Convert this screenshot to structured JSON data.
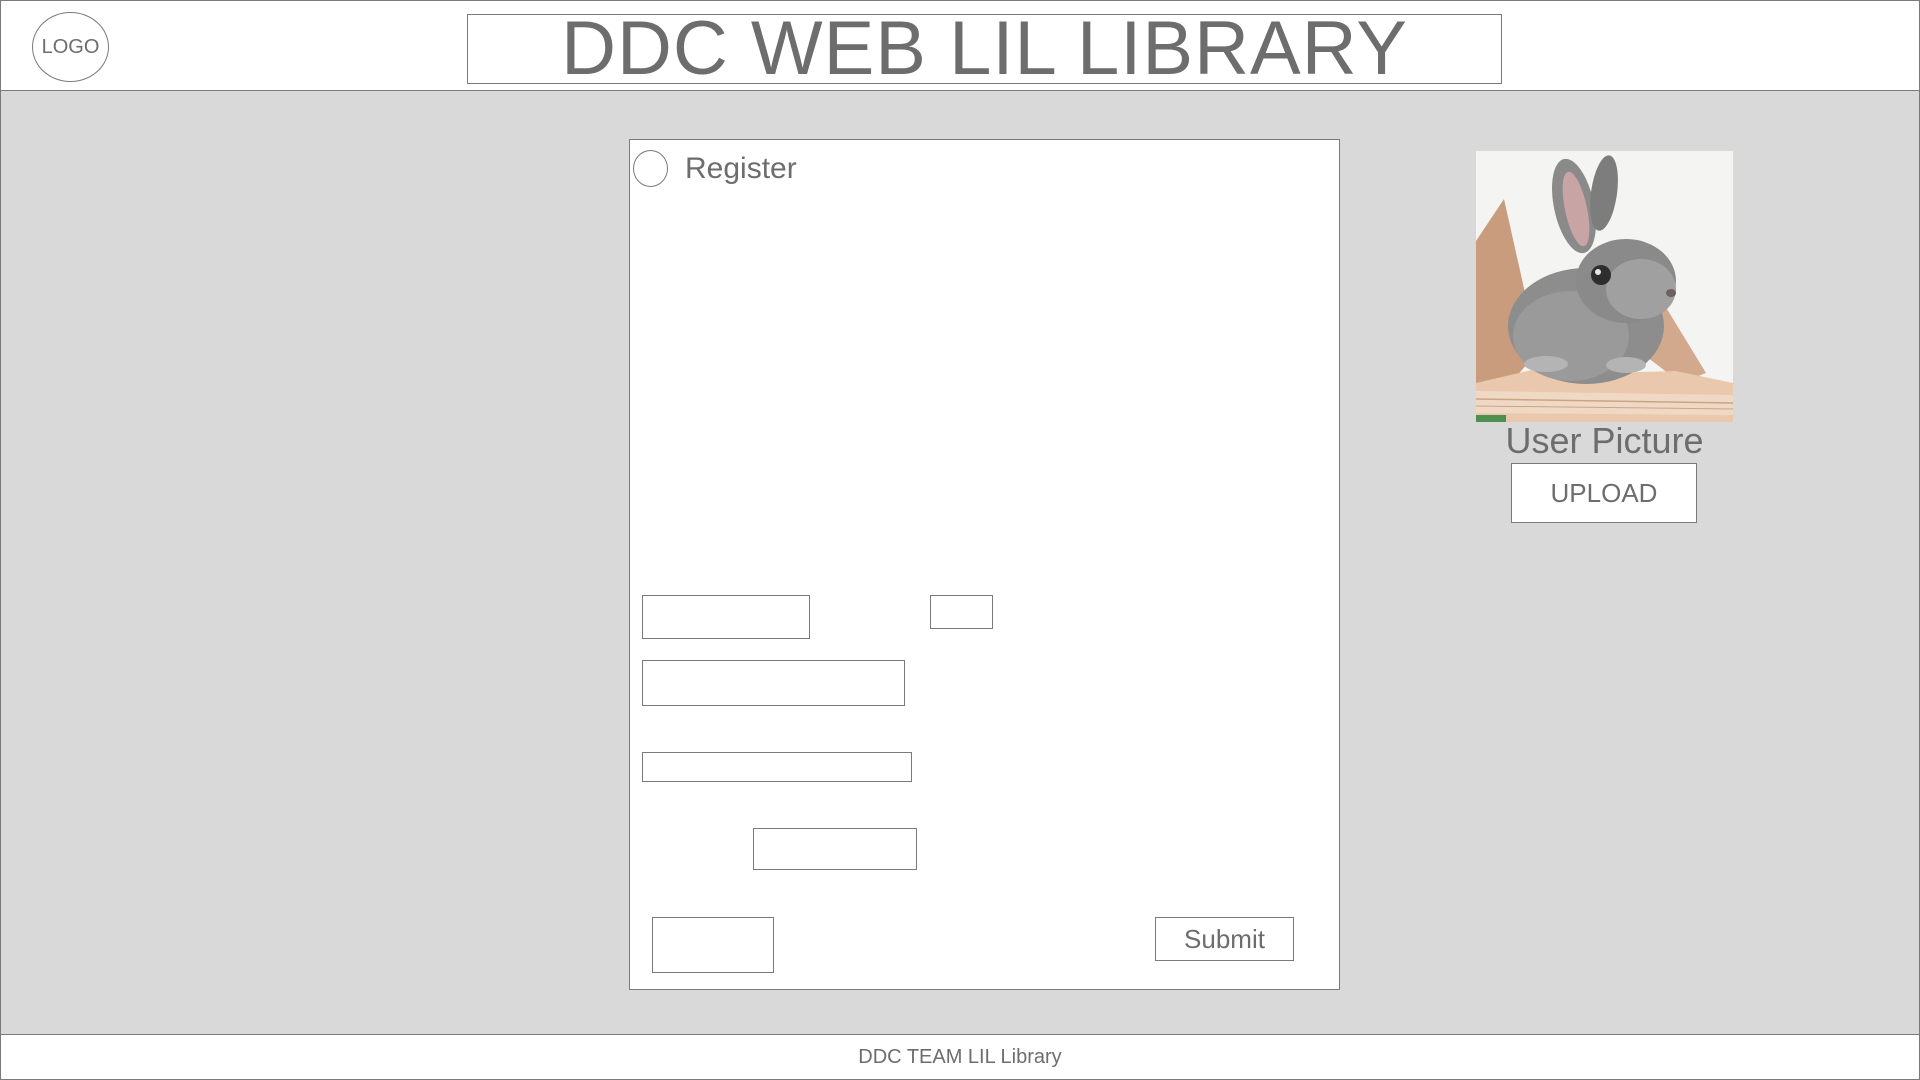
{
  "header": {
    "logo_label": "LOGO",
    "title": "DDC WEB LIL LIBRARY"
  },
  "register": {
    "label": "Register",
    "submit_label": "Submit"
  },
  "user_picture": {
    "label": "User Picture",
    "upload_label": "UPLOAD",
    "image_icon": "rabbit-on-book-photo"
  },
  "footer": {
    "text": "DDC TEAM LIL Library"
  },
  "colors": {
    "background": "#d9d9d9",
    "panel": "#ffffff",
    "border": "#7a7a7a",
    "text": "#6d6d6d"
  }
}
